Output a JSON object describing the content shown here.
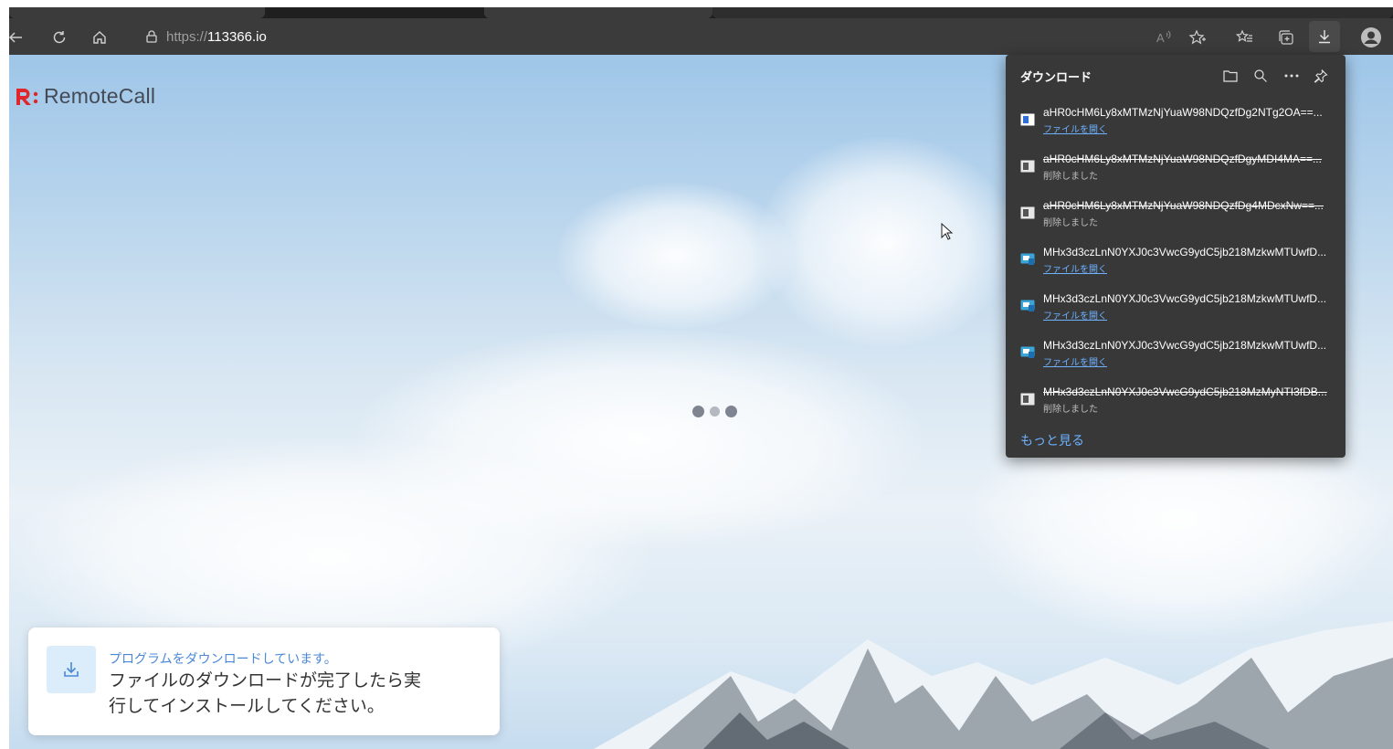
{
  "browser": {
    "url_scheme": "https://",
    "url_host": "113366.io",
    "nav_icons": [
      "back-icon",
      "refresh-icon",
      "home-icon",
      "lock-icon"
    ],
    "toolbar_icons": [
      "read-aloud-icon",
      "add-favorite-icon",
      "favorites-icon",
      "collections-icon",
      "downloads-icon",
      "profile-icon"
    ]
  },
  "page": {
    "logo_mark": "R:",
    "logo_text": "RemoteCall",
    "toast": {
      "title": "プログラムをダウンロードしています。",
      "body": "ファイルのダウンロードが完了したら実行してインストールしてください。"
    }
  },
  "downloads": {
    "title": "ダウンロード",
    "more_label": "もっと見る",
    "items": [
      {
        "name": "aHR0cHM6Ly8xMTMzNjYuaW98NDQzfDg2NTg2OA==...",
        "status": "ファイルを開く",
        "state": "done"
      },
      {
        "name": "aHR0cHM6Ly8xMTMzNjYuaW98NDQzfDgyMDI4MA==...",
        "status": "削除しました",
        "state": "deleted"
      },
      {
        "name": "aHR0cHM6Ly8xMTMzNjYuaW98NDQzfDg4MDcxNw==...",
        "status": "削除しました",
        "state": "deleted"
      },
      {
        "name": "MHx3d3czLnN0YXJ0c3VwcG9ydC5jb218MzkwMTUwfD...",
        "status": "ファイルを開く",
        "state": "exe"
      },
      {
        "name": "MHx3d3czLnN0YXJ0c3VwcG9ydC5jb218MzkwMTUwfD...",
        "status": "ファイルを開く",
        "state": "exe"
      },
      {
        "name": "MHx3d3czLnN0YXJ0c3VwcG9ydC5jb218MzkwMTUwfD...",
        "status": "ファイルを開く",
        "state": "exe"
      },
      {
        "name": "MHx3d3czLnN0YXJ0c3VwcG9ydC5jb218MzMyNTI3fDB...",
        "status": "削除しました",
        "state": "deleted"
      }
    ]
  },
  "colors": {
    "link": "#6db1ff",
    "brand_red": "#e0262b",
    "panel_bg": "#383838"
  }
}
